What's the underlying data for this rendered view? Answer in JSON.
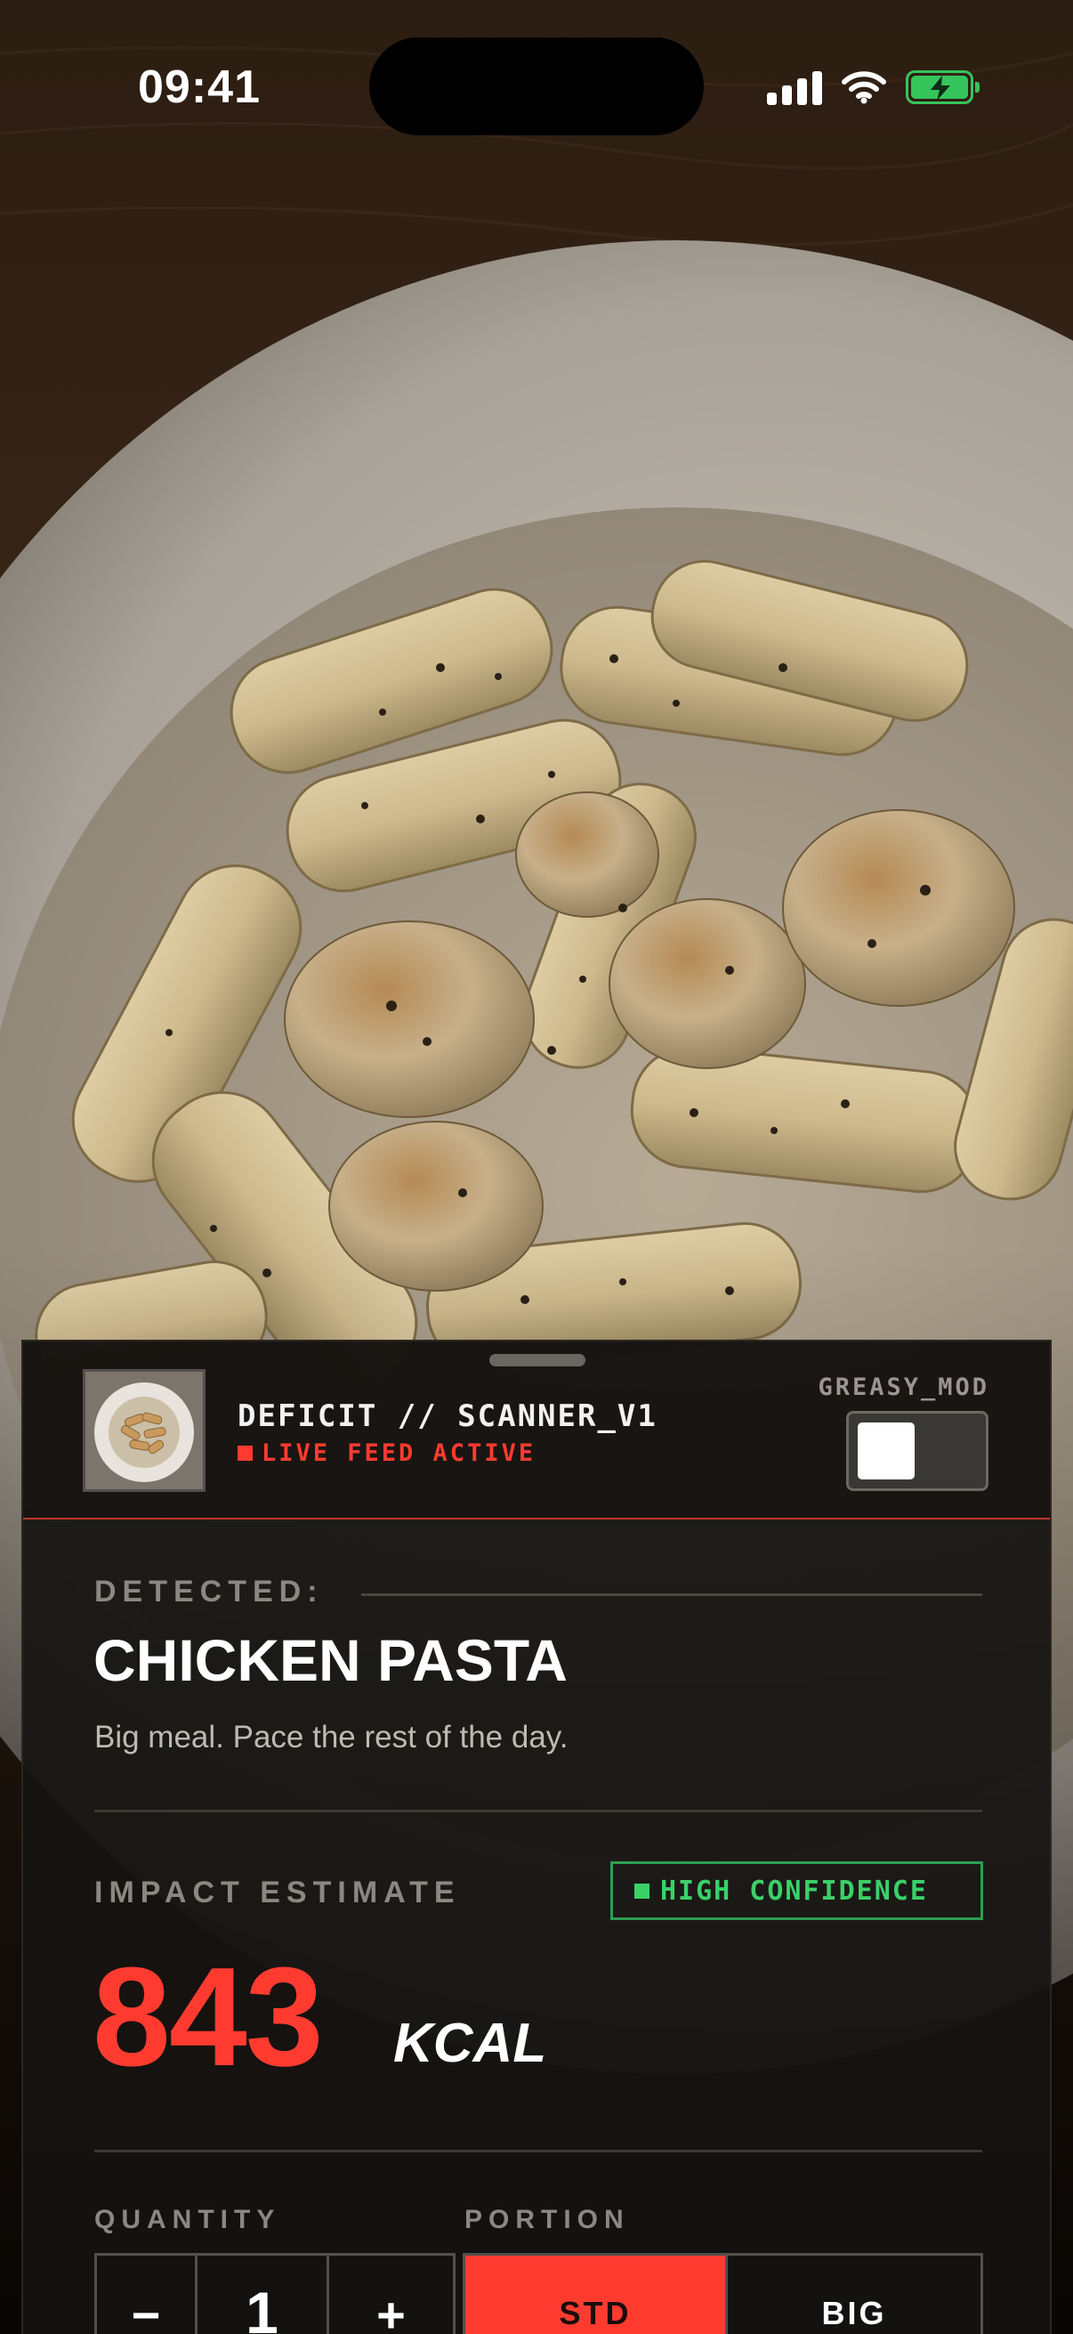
{
  "status_bar": {
    "time": "09:41",
    "icons": [
      "cellular-signal-icon",
      "wifi-icon",
      "battery-charging-icon"
    ],
    "battery_color": "#35c55a"
  },
  "camera_feed": {
    "subject": "plate-of-food-icon"
  },
  "scanner": {
    "title": "DEFICIT // SCANNER_V1",
    "status": "LIVE FEED ACTIVE",
    "greasy_mod": {
      "label": "GREASY_MOD",
      "on": false
    }
  },
  "result": {
    "detected_label": "DETECTED:",
    "food_name": "CHICKEN PASTA",
    "description": "Big meal. Pace the rest of the day.",
    "impact_label": "IMPACT ESTIMATE",
    "confidence": "HIGH CONFIDENCE",
    "calories": "843",
    "unit": "KCAL"
  },
  "controls": {
    "quantity_label": "QUANTITY",
    "quantity": {
      "decrement": "−",
      "value": "1",
      "increment": "+"
    },
    "portion_label": "PORTION",
    "portion_options": [
      "STD",
      "BIG"
    ],
    "portion_selected": "STD"
  },
  "colors": {
    "accent_red": "#ff3b30",
    "confidence_green": "#3ad168",
    "panel_bg": "#161311"
  }
}
